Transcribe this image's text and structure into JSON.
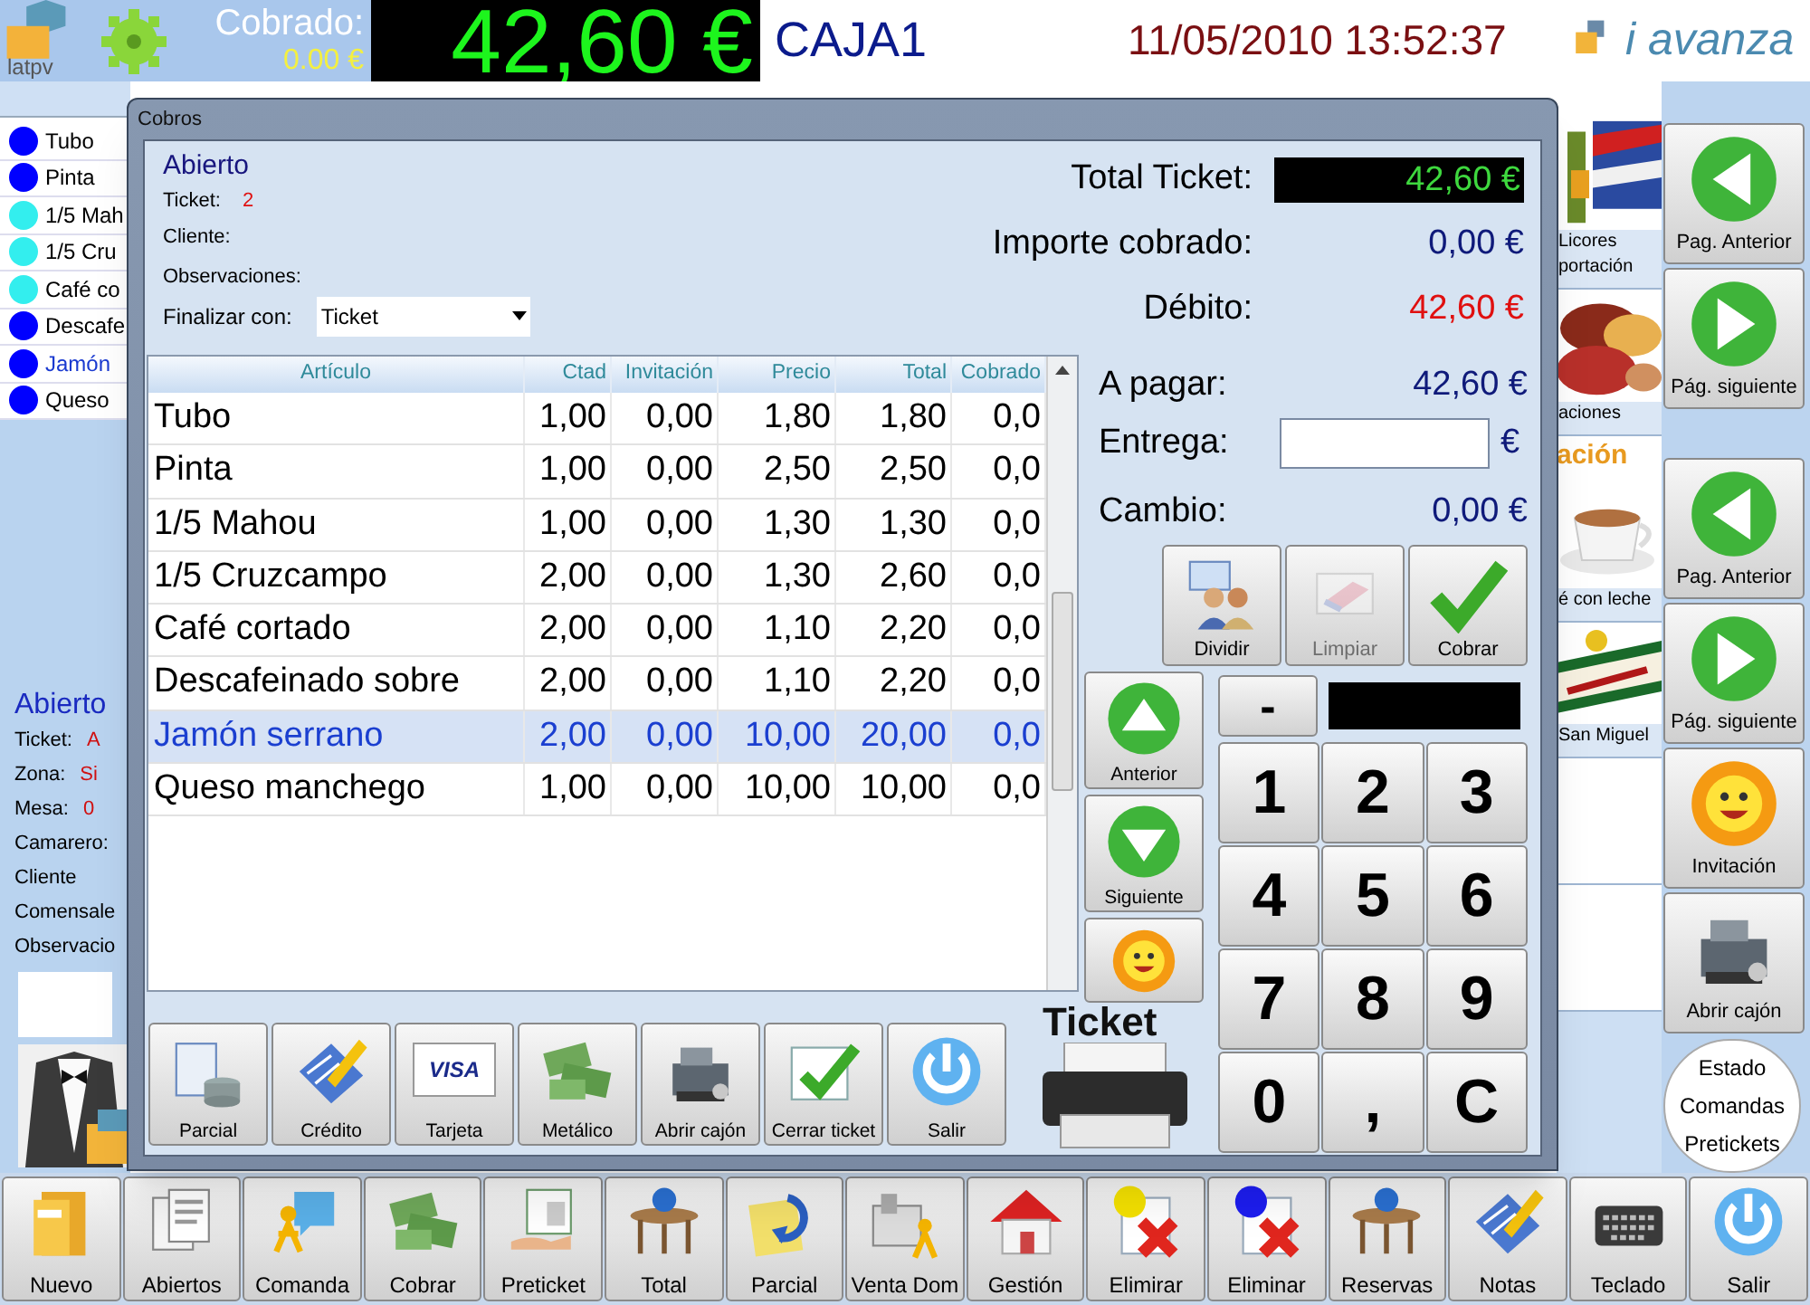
{
  "header": {
    "logo_text": "latpv",
    "cobrado_label": "Cobrado:",
    "cobrado_value": "0.00 €",
    "total": "42,60 €",
    "register": "CAJA1",
    "datetime": "11/05/2010 13:52:37",
    "brand": "i avanza"
  },
  "order_items": [
    {
      "name": "Tubo",
      "color": "#0000ff",
      "selected": false
    },
    {
      "name": "Pinta",
      "color": "#0000ff",
      "selected": false
    },
    {
      "name": "1/5 Mah",
      "color": "#33eeee",
      "selected": false
    },
    {
      "name": "1/5 Cru",
      "color": "#33eeee",
      "selected": false
    },
    {
      "name": "Café co",
      "color": "#33eeee",
      "selected": false
    },
    {
      "name": "Descafe",
      "color": "#0000ff",
      "selected": false
    },
    {
      "name": "Jamón",
      "color": "#0000ff",
      "selected": true
    },
    {
      "name": "Queso",
      "color": "#0000ff",
      "selected": false
    }
  ],
  "order_info": {
    "status": "Abierto",
    "fields": [
      {
        "label": "Ticket:",
        "value": "A"
      },
      {
        "label": "Zona:",
        "value": "Si"
      },
      {
        "label": "Mesa:",
        "value": "0"
      },
      {
        "label": "Camarero:"
      },
      {
        "label": "Cliente"
      },
      {
        "label": "Comensale"
      },
      {
        "label": "Observacio"
      }
    ]
  },
  "families": {
    "tiles": [
      {
        "kind": "tile",
        "lines": [
          "Licores",
          "portación"
        ]
      },
      {
        "kind": "tile",
        "lines": [
          "aciones"
        ]
      },
      {
        "kind": "section",
        "lines": [
          "ación"
        ]
      },
      {
        "kind": "tile",
        "lines": [
          "é con leche"
        ]
      },
      {
        "kind": "tile",
        "lines": [
          "San Miguel"
        ]
      },
      {
        "kind": "empty"
      },
      {
        "kind": "empty"
      }
    ]
  },
  "side_buttons": [
    "Pag. Anterior",
    "Pág. siguiente",
    "Pag. Anterior",
    "Pág. siguiente",
    "Invitación",
    "Abrir cajón"
  ],
  "status_button": [
    "Estado",
    "Comandas",
    "Pretickets"
  ],
  "toolbar": [
    "Nuevo",
    "Abiertos",
    "Comanda",
    "Cobrar",
    "Preticket",
    "Total",
    "Parcial",
    "Venta Dom",
    "Gestión",
    "Elimirar",
    "Eliminar",
    "Reservas",
    "Notas",
    "Teclado",
    "Salir"
  ],
  "dialog": {
    "title": "Cobros",
    "status": "Abierto",
    "ticket_label": "Ticket:",
    "ticket_value": "2",
    "client_label": "Cliente:",
    "notes_label": "Observaciones:",
    "finish_label": "Finalizar con:",
    "finish_value": "Ticket",
    "totals": [
      {
        "label": "Total Ticket:",
        "value": "42,60 €",
        "kind": "display"
      },
      {
        "label": "Importe cobrado:",
        "value": "0,00 €",
        "kind": "paid"
      },
      {
        "label": "Débito:",
        "value": "42,60 €",
        "kind": "debt"
      }
    ],
    "table": {
      "columns": [
        "Artículo",
        "Ctad",
        "Invitación",
        "Precio",
        "Total",
        "Cobrado"
      ],
      "rows": [
        {
          "cells": [
            "Tubo",
            "1,00",
            "0,00",
            "1,80",
            "1,80",
            "0,0"
          ],
          "selected": false
        },
        {
          "cells": [
            "Pinta",
            "1,00",
            "0,00",
            "2,50",
            "2,50",
            "0,0"
          ],
          "selected": false
        },
        {
          "cells": [
            "1/5 Mahou",
            "1,00",
            "0,00",
            "1,30",
            "1,30",
            "0,0"
          ],
          "selected": false
        },
        {
          "cells": [
            "1/5 Cruzcampo",
            "2,00",
            "0,00",
            "1,30",
            "2,60",
            "0,0"
          ],
          "selected": false
        },
        {
          "cells": [
            "Café cortado",
            "2,00",
            "0,00",
            "1,10",
            "2,20",
            "0,0"
          ],
          "selected": false
        },
        {
          "cells": [
            "Descafeinado sobre",
            "2,00",
            "0,00",
            "1,10",
            "2,20",
            "0,0"
          ],
          "selected": false
        },
        {
          "cells": [
            "Jamón serrano",
            "2,00",
            "0,00",
            "10,00",
            "20,00",
            "0,0"
          ],
          "selected": true
        },
        {
          "cells": [
            "Queso manchego",
            "1,00",
            "0,00",
            "10,00",
            "10,00",
            "0,0"
          ],
          "selected": false
        }
      ]
    },
    "payment": {
      "to_pay_label": "A pagar:",
      "to_pay": "42,60 €",
      "tender_label": "Entrega:",
      "currency": "€",
      "change_label": "Cambio:",
      "change": "0,00 €"
    },
    "actions": [
      {
        "label": "Dividir",
        "disabled": false
      },
      {
        "label": "Limpiar",
        "disabled": true
      },
      {
        "label": "Cobrar",
        "disabled": false
      }
    ],
    "nav": [
      "Anterior",
      "Siguiente"
    ],
    "keypad": {
      "minus": "-",
      "keys": [
        "1",
        "2",
        "3",
        "4",
        "5",
        "6",
        "7",
        "8",
        "9",
        "0",
        ",",
        "C"
      ]
    },
    "methods": [
      {
        "label": "Parcial"
      },
      {
        "label": "Crédito"
      },
      {
        "label": "Tarjeta",
        "badge": "VISA"
      },
      {
        "label": "Metálico"
      },
      {
        "label": "Abrir cajón"
      },
      {
        "label": "Cerrar ticket"
      },
      {
        "label": "Salir"
      }
    ],
    "printer_label": "Ticket"
  }
}
